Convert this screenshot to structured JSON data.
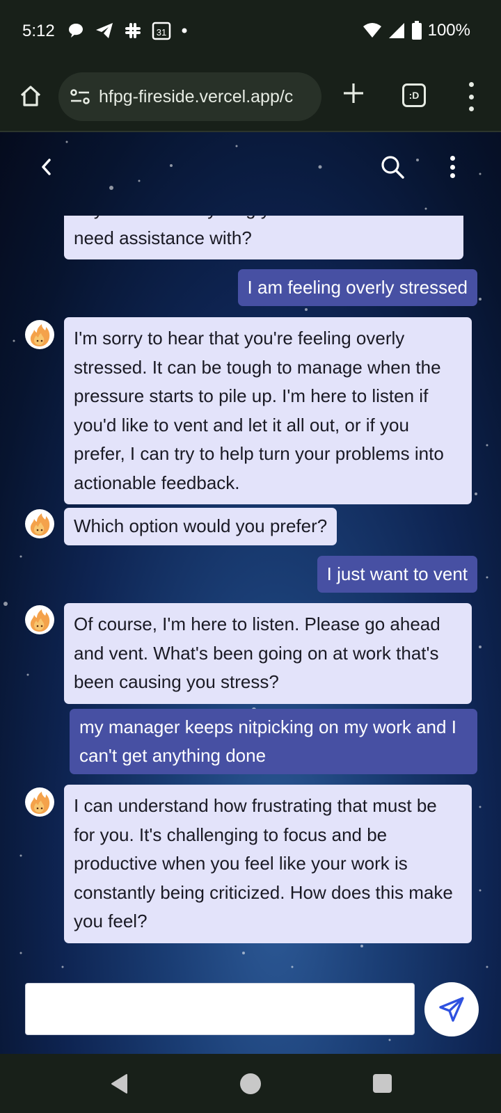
{
  "status_bar": {
    "time": "5:12",
    "calendar_day": "31",
    "battery": "100%"
  },
  "browser": {
    "url": "hfpg-fireside.vercel.app/c",
    "tabs_label": ":D"
  },
  "chat": {
    "messages": [
      {
        "role": "bot",
        "text": "days. Is there anything you'd like to discuss or need assistance with?"
      },
      {
        "role": "user",
        "text": "I am feeling overly stressed"
      },
      {
        "role": "bot",
        "text": "I'm sorry to hear that you're feeling overly stressed. It can be tough to manage when the pressure starts to pile up. I'm here to listen if you'd like to vent and let it all out, or if you prefer, I can try to help turn your problems into actionable feedback."
      },
      {
        "role": "bot",
        "text": "Which option would you prefer?"
      },
      {
        "role": "user",
        "text": "I just want to vent"
      },
      {
        "role": "bot",
        "text": "Of course, I'm here to listen. Please go ahead and vent. What's been going on at work that's been causing you stress?"
      },
      {
        "role": "user",
        "text": "my manager keeps nitpicking on my work and I can't get anything done"
      },
      {
        "role": "bot",
        "text": "I can understand how frustrating that must be for you. It's challenging to focus and be productive when you feel like your work is constantly being criticized. How does this make you feel?"
      }
    ]
  },
  "composer": {
    "value": ""
  },
  "colors": {
    "bot_bubble": "#e3e3fa",
    "user_bubble": "#4750a3",
    "send_icon": "#2f52e0"
  }
}
